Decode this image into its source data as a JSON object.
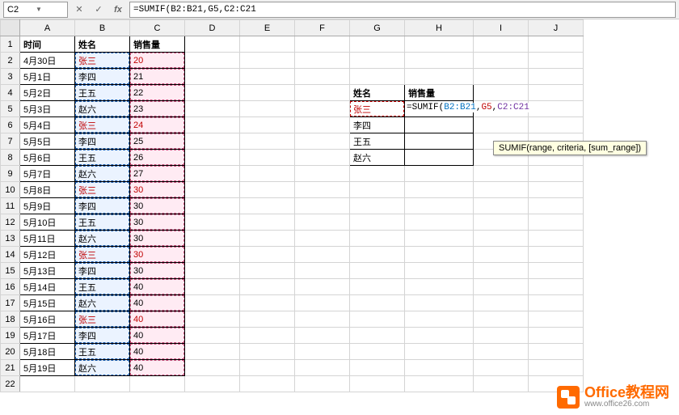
{
  "nameBox": "C2",
  "formulaBar": "=SUMIF(B2:B21,G5,C2:C21",
  "columns": [
    "A",
    "B",
    "C",
    "D",
    "E",
    "F",
    "G",
    "H",
    "I",
    "J"
  ],
  "rowCount": 22,
  "headers": {
    "A": "时间",
    "B": "姓名",
    "C": "销售量"
  },
  "table_rows": [
    {
      "time": "4月30日",
      "name": "张三",
      "sales": 20,
      "red": true
    },
    {
      "time": "5月1日",
      "name": "李四",
      "sales": 21,
      "red": false
    },
    {
      "time": "5月2日",
      "name": "王五",
      "sales": 22,
      "red": false
    },
    {
      "time": "5月3日",
      "name": "赵六",
      "sales": 23,
      "red": false
    },
    {
      "time": "5月4日",
      "name": "张三",
      "sales": 24,
      "red": true
    },
    {
      "time": "5月5日",
      "name": "李四",
      "sales": 25,
      "red": false
    },
    {
      "time": "5月6日",
      "name": "王五",
      "sales": 26,
      "red": false
    },
    {
      "time": "5月7日",
      "name": "赵六",
      "sales": 27,
      "red": false
    },
    {
      "time": "5月8日",
      "name": "张三",
      "sales": 30,
      "red": true
    },
    {
      "time": "5月9日",
      "name": "李四",
      "sales": 30,
      "red": false
    },
    {
      "time": "5月10日",
      "name": "王五",
      "sales": 30,
      "red": false
    },
    {
      "time": "5月11日",
      "name": "赵六",
      "sales": 30,
      "red": false
    },
    {
      "time": "5月12日",
      "name": "张三",
      "sales": 30,
      "red": true
    },
    {
      "time": "5月13日",
      "name": "李四",
      "sales": 30,
      "red": false
    },
    {
      "time": "5月14日",
      "name": "王五",
      "sales": 40,
      "red": false
    },
    {
      "time": "5月15日",
      "name": "赵六",
      "sales": 40,
      "red": false
    },
    {
      "time": "5月16日",
      "name": "张三",
      "sales": 40,
      "red": true
    },
    {
      "time": "5月17日",
      "name": "李四",
      "sales": 40,
      "red": false
    },
    {
      "time": "5月18日",
      "name": "王五",
      "sales": 40,
      "red": false
    },
    {
      "time": "5月19日",
      "name": "赵六",
      "sales": 40,
      "red": false
    }
  ],
  "summary": {
    "header_name": "姓名",
    "header_sales": "销售量",
    "rows": [
      "张三",
      "李四",
      "王五",
      "赵六"
    ]
  },
  "editFormula": {
    "prefix": "=SUMIF(",
    "arg1": "B2:B21",
    "sep1": ",",
    "arg2": "G5",
    "sep2": ",",
    "arg3": "C2:C21"
  },
  "tooltip": "SUMIF(range, criteria, [sum_range])",
  "watermark": {
    "title": "Office教程网",
    "url": "www.office26.com"
  }
}
